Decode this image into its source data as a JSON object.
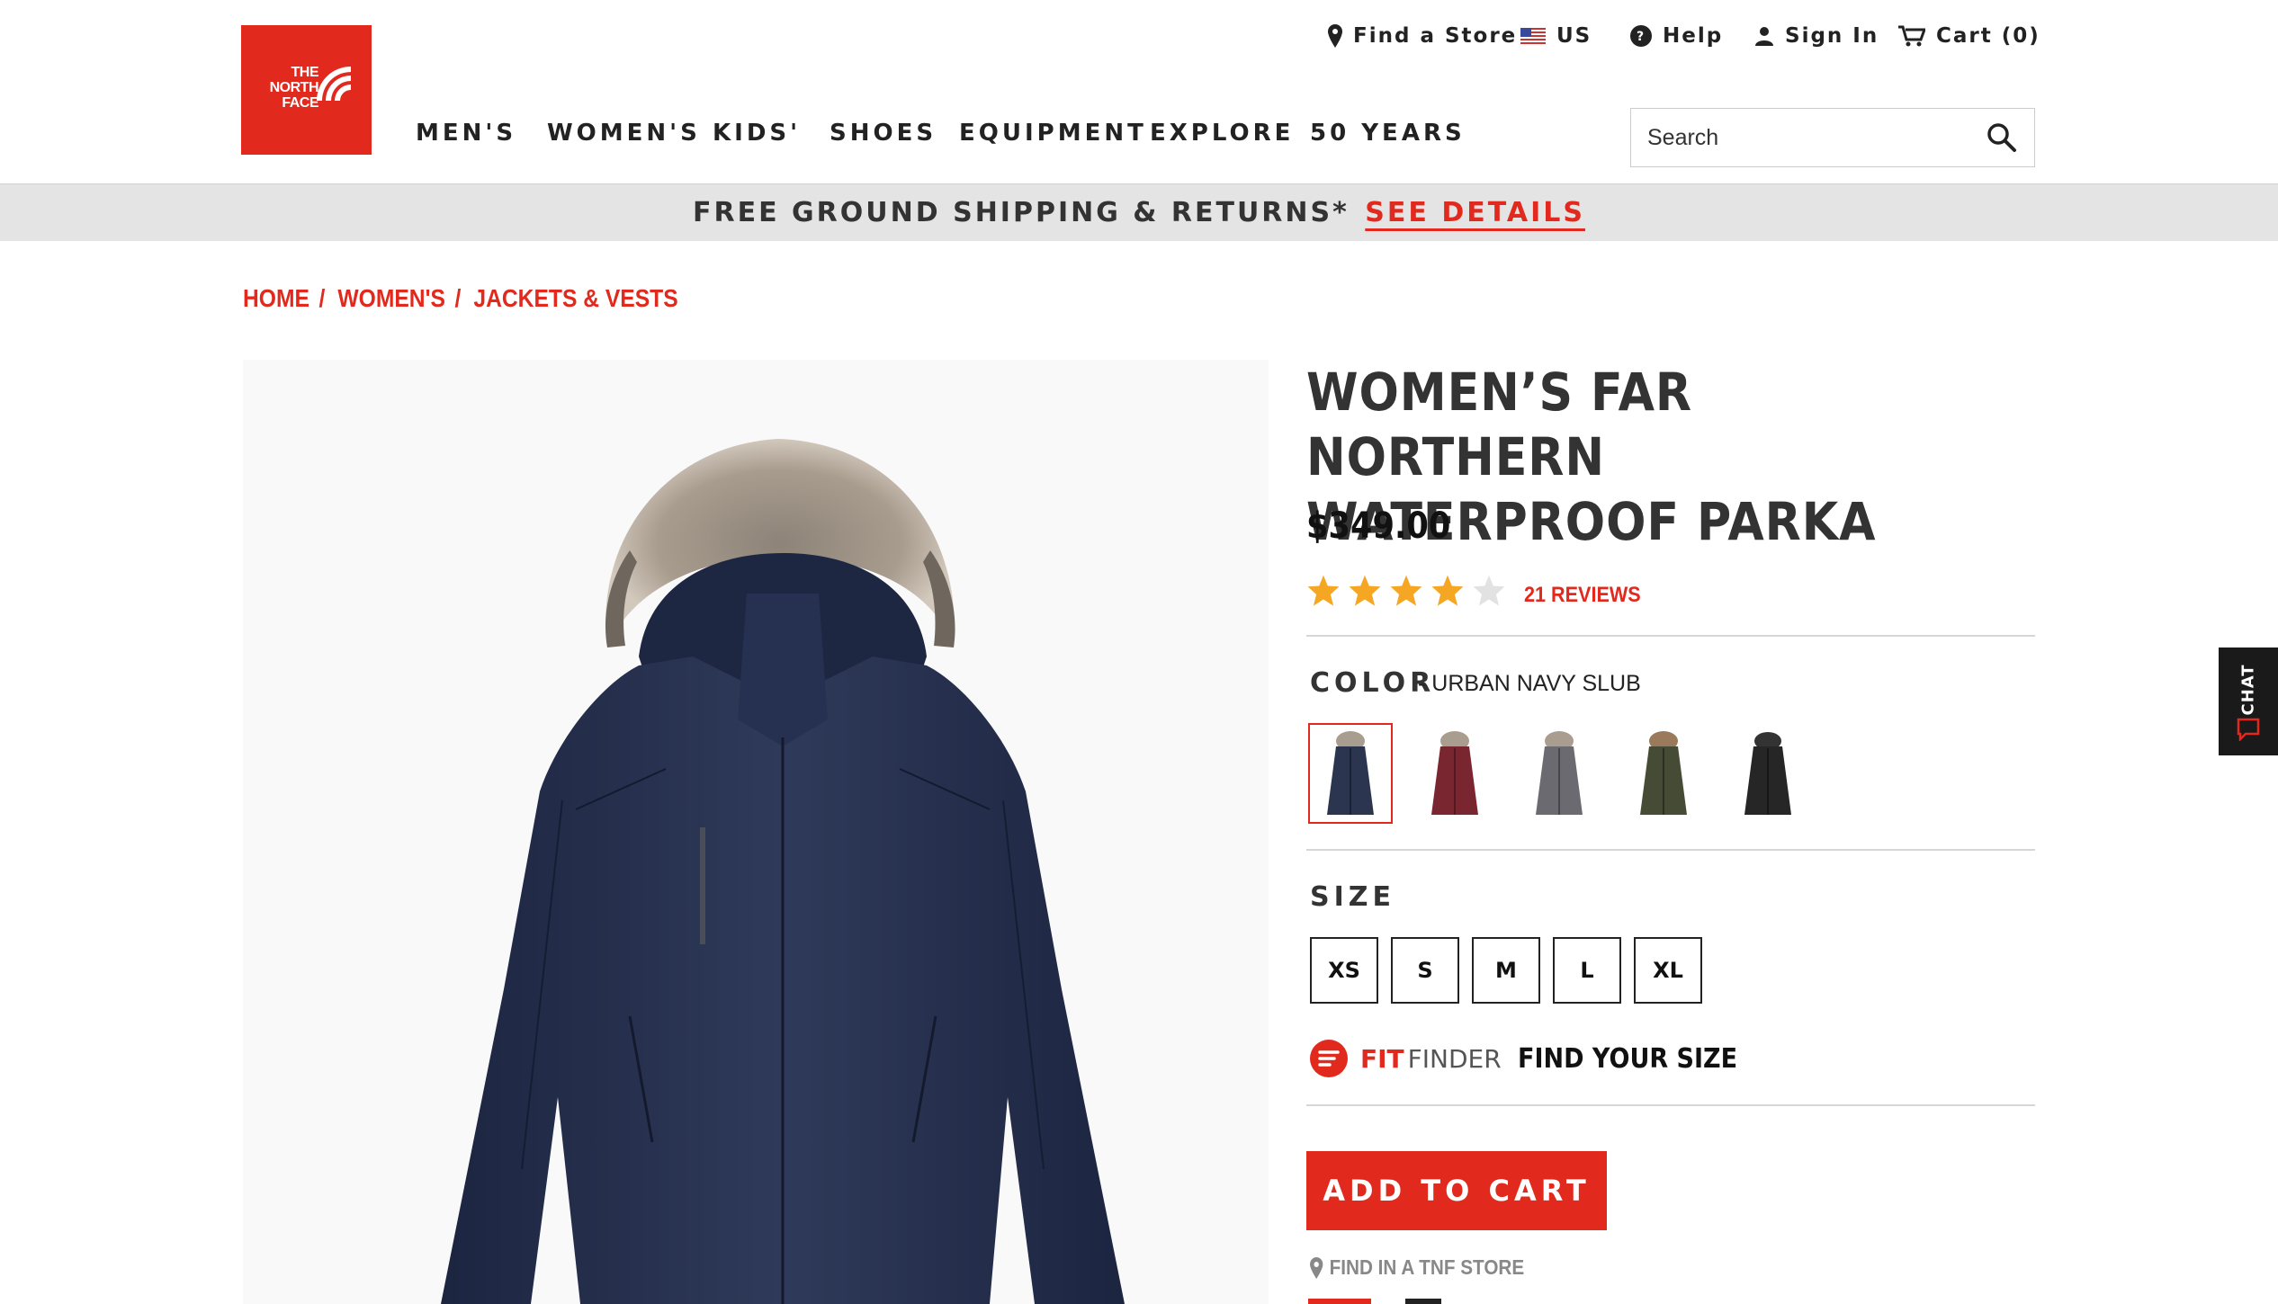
{
  "brand": {
    "logo_text": [
      "THE",
      "NORTH",
      "FACE"
    ],
    "accent_color": "#e1291e"
  },
  "utility_nav": {
    "find_store": "Find a Store",
    "region": "US",
    "help": "Help",
    "sign_in": "Sign In",
    "cart": "Cart (0)"
  },
  "main_nav": [
    "MEN'S",
    "WOMEN'S",
    "KIDS'",
    "SHOES",
    "EQUIPMENT",
    "EXPLORE",
    "50 YEARS"
  ],
  "search": {
    "placeholder": "Search"
  },
  "promo": {
    "text": "FREE GROUND SHIPPING & RETURNS*",
    "link": "SEE DETAILS"
  },
  "breadcrumb": [
    "HOME",
    "WOMEN'S",
    "JACKETS & VESTS"
  ],
  "product": {
    "title_line1": "WOMEN’S FAR NORTHERN",
    "title_line2": "WATERPROOF PARKA",
    "price": "$349.00",
    "rating": 4,
    "rating_max": 5,
    "reviews": "21 REVIEWS",
    "color_label": "COLOR",
    "color_name": "- URBAN NAVY SLUB",
    "swatches": [
      {
        "color": "#2b3550",
        "selected": true
      },
      {
        "color": "#7a2630",
        "selected": false
      },
      {
        "color": "#6a6a70",
        "selected": false
      },
      {
        "color": "#464b35",
        "selected": false
      },
      {
        "color": "#262626",
        "selected": false
      }
    ],
    "size_label": "SIZE",
    "sizes": [
      "XS",
      "S",
      "M",
      "L",
      "XL"
    ],
    "fit_finder": {
      "fit": "FIT",
      "finder": "FINDER",
      "cta": "FIND YOUR SIZE"
    },
    "add_to_cart": "ADD TO CART",
    "find_in_store": "FIND IN A TNF STORE"
  },
  "chat": {
    "label": "CHAT"
  }
}
